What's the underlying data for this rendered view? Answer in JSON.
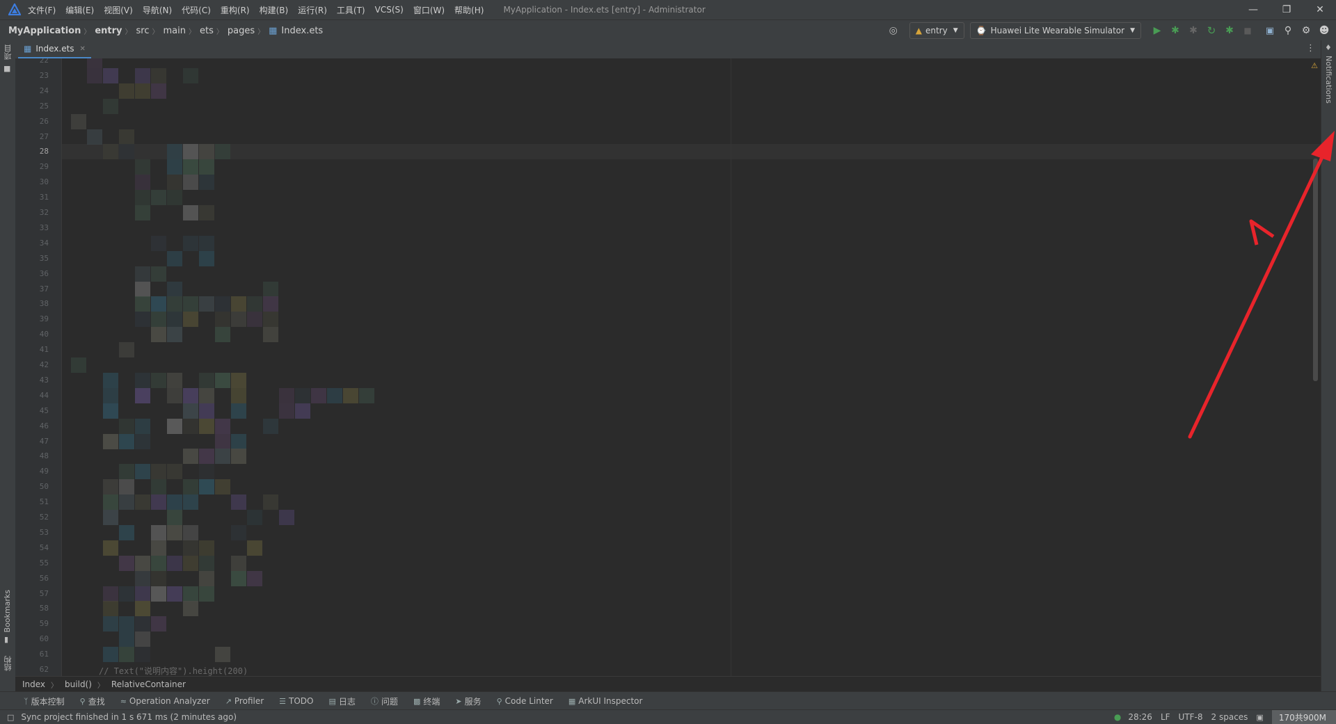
{
  "titlebar": {
    "menus": [
      "文件(F)",
      "编辑(E)",
      "视图(V)",
      "导航(N)",
      "代码(C)",
      "重构(R)",
      "构建(B)",
      "运行(R)",
      "工具(T)",
      "VCS(S)",
      "窗口(W)",
      "帮助(H)"
    ],
    "window_title": "MyApplication - Index.ets [entry] - Administrator"
  },
  "navbar": {
    "breadcrumbs": [
      "MyApplication",
      "entry",
      "src",
      "main",
      "ets",
      "pages",
      "Index.ets"
    ],
    "module_dropdown": "entry",
    "device_dropdown": "Huawei Lite Wearable Simulator"
  },
  "left_strip": {
    "top_label": "项目",
    "bookmarks_label": "Bookmarks",
    "structure_label": "结构"
  },
  "right_strip": {
    "notifications_label": "Notifications"
  },
  "tab": {
    "label": "Index.ets"
  },
  "editor": {
    "line_numbers": [
      "22",
      "23",
      "24",
      "25",
      "26",
      "27",
      "28",
      "29",
      "30",
      "31",
      "32",
      "33",
      "34",
      "35",
      "36",
      "37",
      "38",
      "39",
      "40",
      "41",
      "42",
      "43",
      "44",
      "45",
      "46",
      "47",
      "48",
      "49",
      "50",
      "51",
      "52",
      "53",
      "54",
      "55",
      "56",
      "57",
      "58",
      "59",
      "60",
      "61",
      "62"
    ],
    "current_line": "28",
    "partial_code": "//        Text(\"说明内容\").height(200)"
  },
  "bottom_breadcrumb": [
    "Index",
    "build()",
    "RelativeContainer"
  ],
  "tool_windows": [
    {
      "label": "版本控制",
      "icon": "git-branch-icon"
    },
    {
      "label": "查找",
      "icon": "search-icon"
    },
    {
      "label": "Operation Analyzer",
      "icon": "chart-icon"
    },
    {
      "label": "Profiler",
      "icon": "profiler-icon"
    },
    {
      "label": "TODO",
      "icon": "list-icon"
    },
    {
      "label": "日志",
      "icon": "log-icon"
    },
    {
      "label": "问题",
      "icon": "info-icon"
    },
    {
      "label": "终端",
      "icon": "terminal-icon"
    },
    {
      "label": "服务",
      "icon": "services-icon"
    },
    {
      "label": "Code Linter",
      "icon": "linter-icon"
    },
    {
      "label": "ArkUI Inspector",
      "icon": "inspector-icon"
    }
  ],
  "statusbar": {
    "message": "Sync project finished in 1 s 671 ms (2 minutes ago)",
    "position": "28:26",
    "line_separator": "LF",
    "encoding": "UTF-8",
    "indent": "2 spaces",
    "memory": "170共900M"
  },
  "colors": {
    "accent": "#4a88c7",
    "run_green": "#499c54",
    "annotation_red": "#e8242b"
  }
}
